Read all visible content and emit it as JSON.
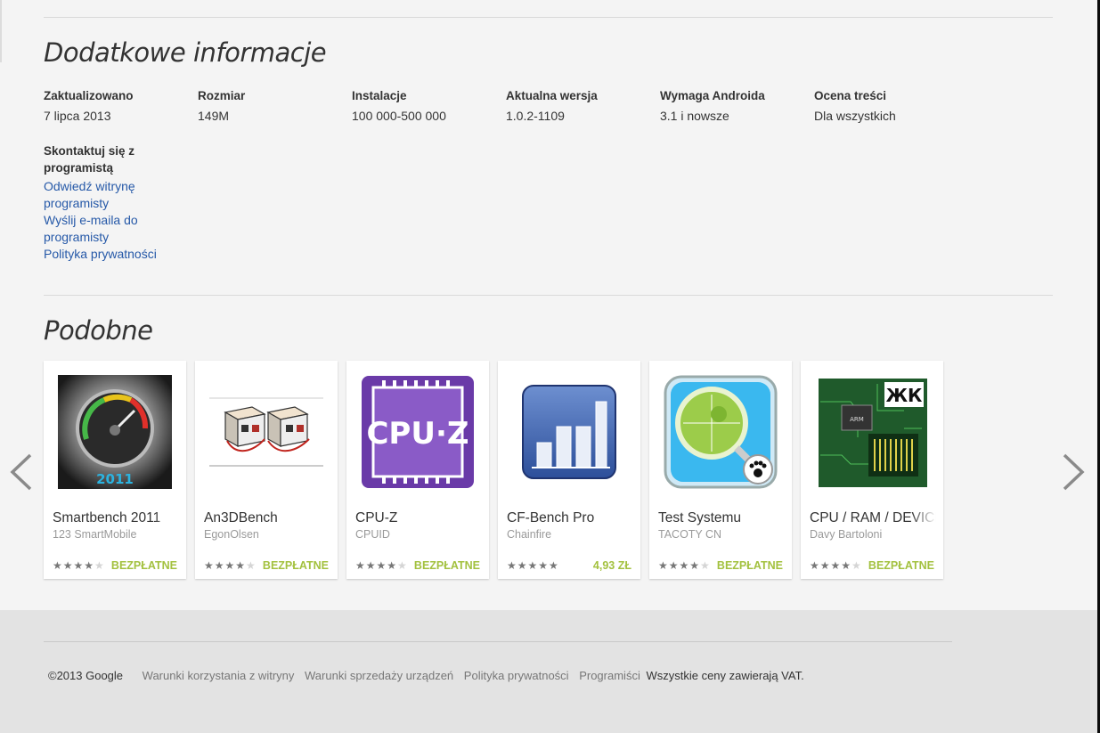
{
  "additional_info": {
    "title": "Dodatkowe informacje",
    "fields": [
      {
        "label": "Zaktualizowano",
        "value": "7 lipca 2013"
      },
      {
        "label": "Rozmiar",
        "value": "149M"
      },
      {
        "label": "Instalacje",
        "value": "100 000-500 000"
      },
      {
        "label": "Aktualna wersja",
        "value": "1.0.2-1109"
      },
      {
        "label": "Wymaga Androida",
        "value": "3.1 i nowsze"
      },
      {
        "label": "Ocena treści",
        "value": "Dla wszystkich"
      }
    ],
    "contact": {
      "label": "Skontaktuj się z programistą",
      "links": [
        "Odwiedź witrynę programisty",
        "Wyślij e-maila do programisty",
        "Polityka prywatności"
      ]
    }
  },
  "similar": {
    "title": "Podobne",
    "apps": [
      {
        "name": "Smartbench 2011",
        "developer": "123 SmartMobile",
        "rating": 3.5,
        "price": "BEZPŁATNE",
        "icon": "speedometer-icon"
      },
      {
        "name": "An3DBench",
        "developer": "EgonOlsen",
        "rating": 4.5,
        "price": "BEZPŁATNE",
        "icon": "3d-blocks-icon"
      },
      {
        "name": "CPU-Z",
        "developer": "CPUID",
        "rating": 4.5,
        "price": "BEZPŁATNE",
        "icon": "cpu-chip-icon"
      },
      {
        "name": "CF-Bench Pro",
        "developer": "Chainfire",
        "rating": 4.5,
        "price": "4,93 ZŁ",
        "icon": "bar-chart-icon"
      },
      {
        "name": "Test Systemu",
        "developer": "TACOTY CN",
        "rating": 4,
        "price": "BEZPŁATNE",
        "icon": "android-magnifier-icon"
      },
      {
        "name": "CPU / RAM / DEVICE IDENTIFIER",
        "developer": "Davy Bartoloni",
        "rating": 4.5,
        "price": "BEZPŁATNE",
        "icon": "circuit-board-icon"
      }
    ]
  },
  "footer": {
    "copyright": "©2013 Google",
    "links": [
      "Warunki korzystania z witryny",
      "Warunki sprzedaży urządzeń",
      "Polityka prywatności",
      "Programiści"
    ],
    "note": "Wszystkie ceny zawierają VAT."
  }
}
